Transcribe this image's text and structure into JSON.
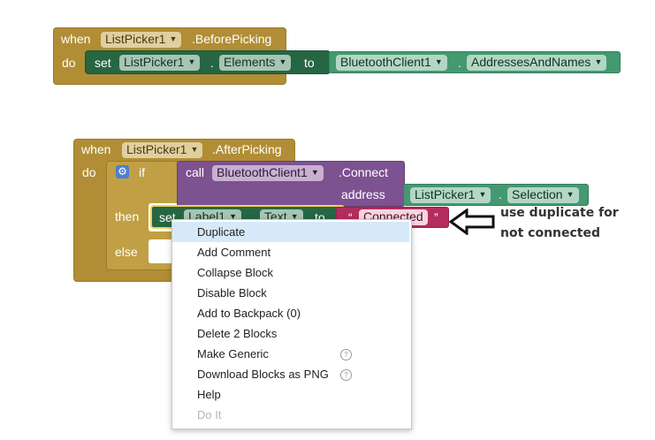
{
  "block1": {
    "when": "when",
    "component": "ListPicker1",
    "event": ".BeforePicking",
    "do": "do",
    "set": {
      "keyword": "set",
      "component": "ListPicker1",
      "property": "Elements",
      "to": "to"
    },
    "value": {
      "component": "BluetoothClient1",
      "dot": ".",
      "property": "AddressesAndNames"
    }
  },
  "block2": {
    "when": "when",
    "component": "ListPicker1",
    "event": ".AfterPicking",
    "do": "do",
    "if": {
      "keyword": "if",
      "then": "then",
      "else": "else"
    },
    "call": {
      "keyword": "call",
      "component": "BluetoothClient1",
      "method": ".Connect",
      "param": "address"
    },
    "address_value": {
      "component": "ListPicker1",
      "dot": ".",
      "property": "Selection"
    },
    "then_set": {
      "keyword": "set",
      "component": "Label1",
      "property": "Text",
      "to": "to"
    },
    "text_value": {
      "open_quote": "“",
      "text": "Connected",
      "close_quote": "”"
    }
  },
  "annotation": {
    "line1": "use duplicate for",
    "line2": "not connected"
  },
  "context_menu": {
    "items": [
      {
        "label": "Duplicate"
      },
      {
        "label": "Add Comment"
      },
      {
        "label": "Collapse Block"
      },
      {
        "label": "Disable Block"
      },
      {
        "label": "Add to Backpack (0)"
      },
      {
        "label": "Delete 2 Blocks"
      },
      {
        "label": "Make Generic",
        "help": "?"
      },
      {
        "label": "Download Blocks as PNG",
        "help": "?"
      },
      {
        "label": "Help"
      },
      {
        "label": "Do It"
      }
    ]
  },
  "icons": {
    "dropdown_arrow": "▼",
    "gear": "gear-icon",
    "arrow": "left-arrow-icon"
  },
  "colors": {
    "event_block": "#b18e35",
    "setter_block": "#266643",
    "getter_block": "#439970",
    "method_block": "#7d5290",
    "text_block": "#b32d5e",
    "menu_highlight": "#d6e9f8"
  }
}
